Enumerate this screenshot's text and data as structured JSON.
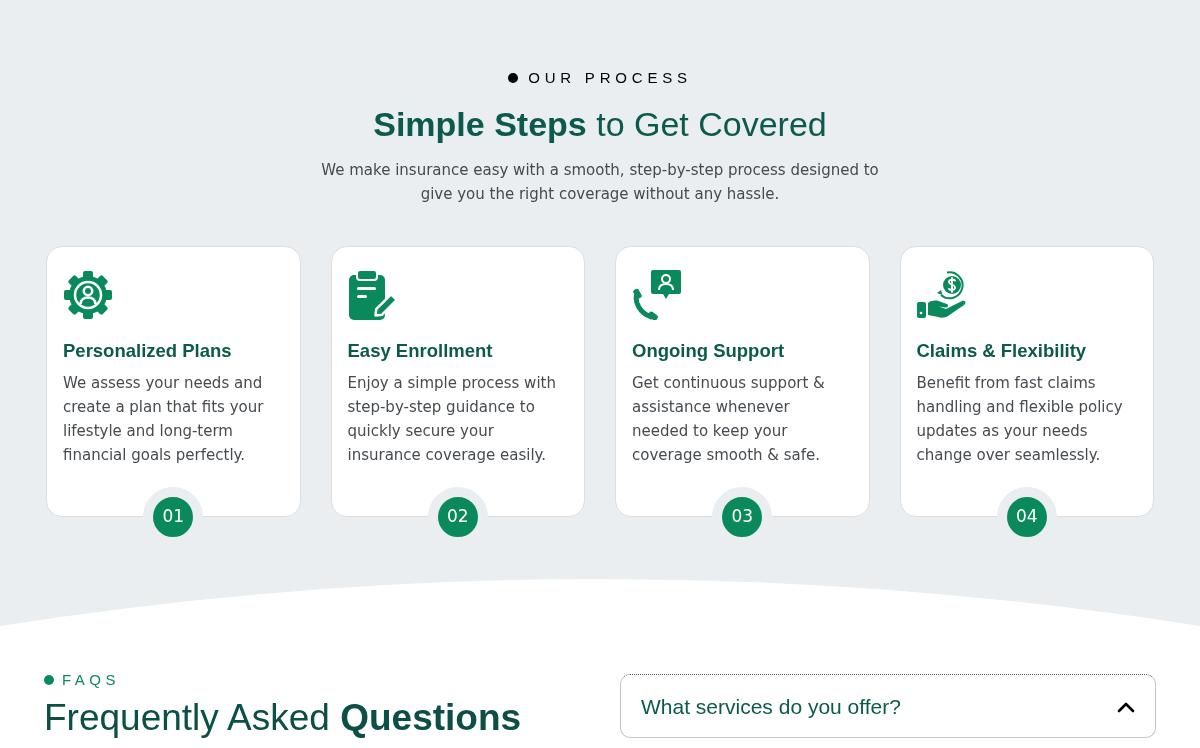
{
  "process": {
    "eyebrow": "OUR PROCESS",
    "heading": "**Simple Steps** to Get Covered",
    "intro": "We make insurance easy with a smooth, step-by-step process designed to give you the right coverage without any hassle.",
    "steps": [
      {
        "kind": "gear",
        "title": "Personalized Plans",
        "description": "We assess your needs and create a plan that fits your lifestyle and long-term financial goals perfectly.",
        "number": "01"
      },
      {
        "kind": "clipboard",
        "title": "Easy Enrollment",
        "description": "Enjoy a simple process with step-by-step guidance to quickly secure your insurance coverage easily.",
        "number": "02"
      },
      {
        "kind": "phone",
        "title": "Ongoing Support",
        "description": "Get continuous support & assistance whenever needed to keep your coverage smooth & safe.",
        "number": "03"
      },
      {
        "kind": "hand",
        "title": "Claims & Flexibility",
        "description": "Benefit from fast claims handling and flexible policy updates as your needs change over seamlessly.",
        "number": "04"
      }
    ]
  },
  "faq": {
    "eyebrow": "FAQS",
    "heading": "Frequently Asked **Questions**",
    "items": [
      {
        "question": "What services do you offer?",
        "expanded": true
      }
    ]
  }
}
